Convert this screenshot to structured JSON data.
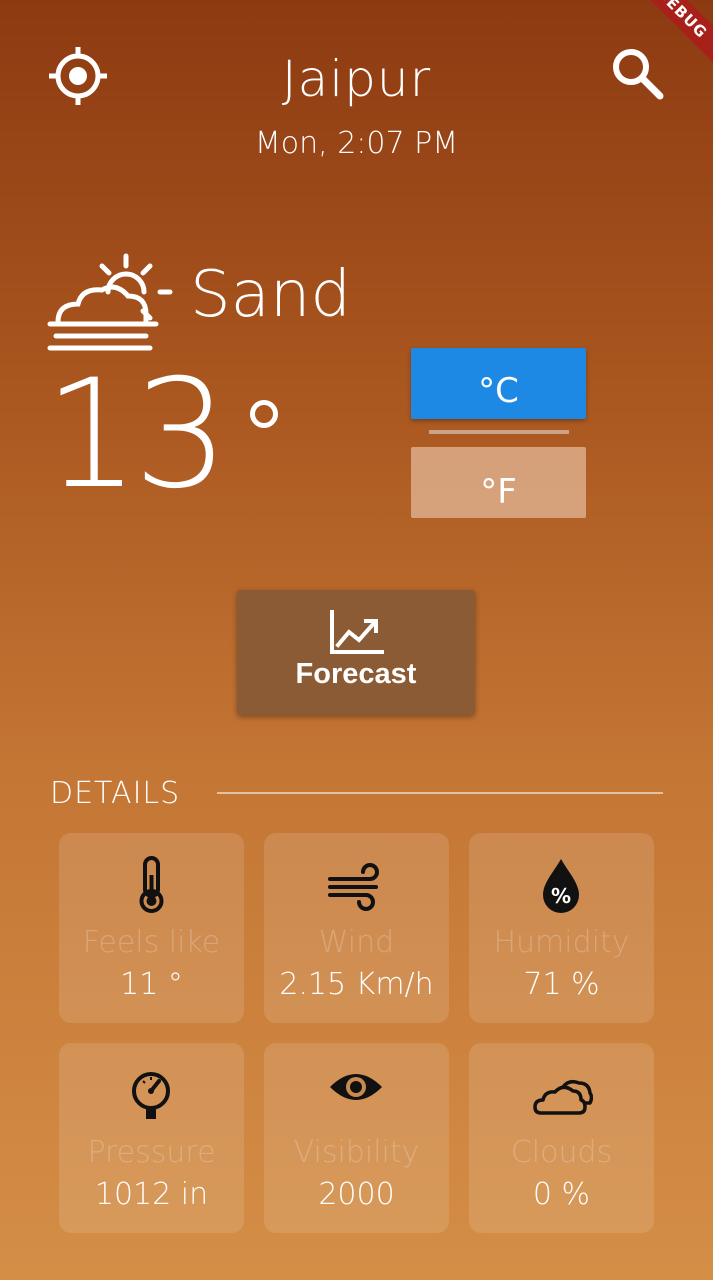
{
  "debug_banner": "DEBUG",
  "header": {
    "city": "Jaipur",
    "datetime": "Mon, 2:07 PM",
    "location_icon": "crosshair-location-icon",
    "search_icon": "search-icon"
  },
  "current": {
    "condition_icon": "sun-behind-cloud-haze-icon",
    "condition": "Sand",
    "temperature": "13"
  },
  "units": {
    "celsius": "°C",
    "fahrenheit": "°F",
    "selected": "celsius",
    "selected_color": "#1e88e5"
  },
  "forecast_button": {
    "icon": "trending-up-chart-icon",
    "label": "Forecast"
  },
  "details": {
    "title": "DETAILS",
    "items": [
      {
        "icon": "thermometer-icon",
        "label": "Feels like",
        "value": "11 °"
      },
      {
        "icon": "wind-icon",
        "label": "Wind",
        "value": "2.15 Km/h"
      },
      {
        "icon": "humidity-drop-percent-icon",
        "label": "Humidity",
        "value": "71 %"
      },
      {
        "icon": "pressure-gauge-icon",
        "label": "Pressure",
        "value": "1012 in"
      },
      {
        "icon": "eye-icon",
        "label": "Visibility",
        "value": "2000"
      },
      {
        "icon": "clouds-icon",
        "label": "Clouds",
        "value": "0 %"
      }
    ]
  }
}
